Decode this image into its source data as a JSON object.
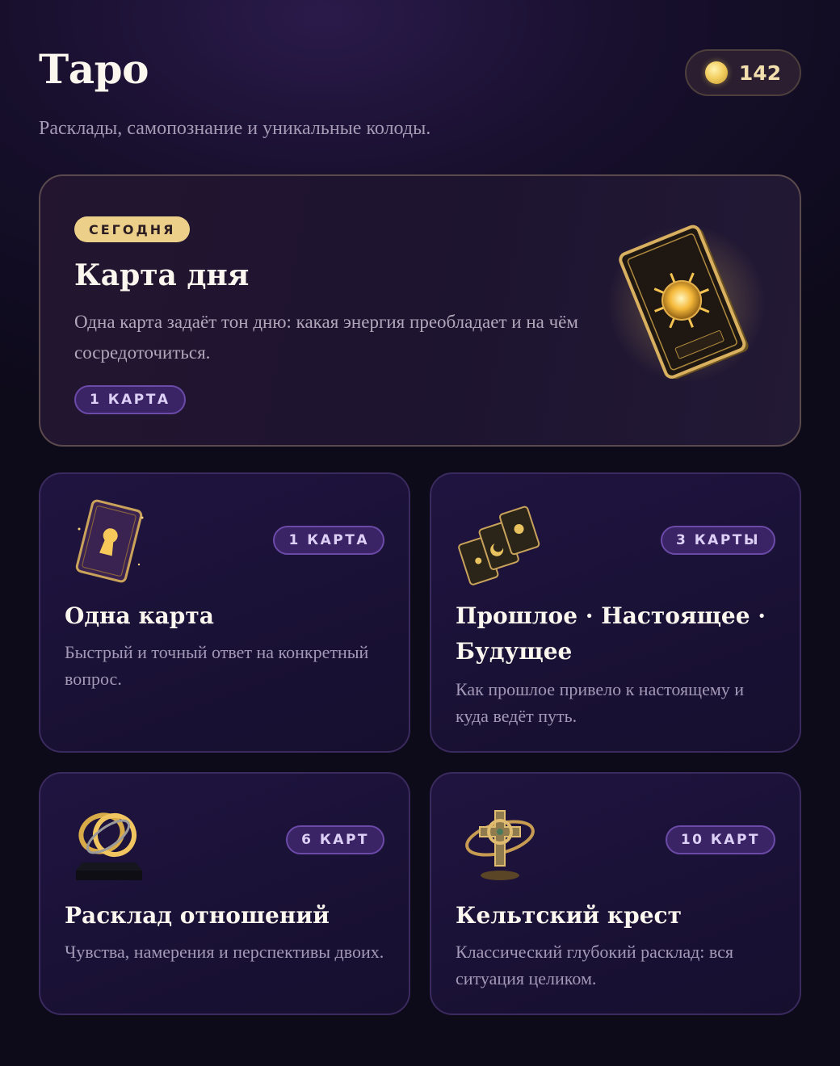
{
  "header": {
    "title": "Таро",
    "coins": "142",
    "coin_icon": "gold-coin-icon"
  },
  "subtitle": "Расклады, самопознание и уникальные колоды.",
  "featured": {
    "badge": "СЕГОДНЯ",
    "title": "Карта дня",
    "description": "Одна карта задаёт тон дню: какая энергия преобладает и на чём сосредоточиться.",
    "count": "1 КАРТА",
    "art_icon": "sun-tarot-card-image"
  },
  "spreads": [
    {
      "title": "Одна карта",
      "description": "Быстрый и точный ответ на конкретный вопрос.",
      "count": "1 КАРТА",
      "icon": "keyhole-card-image"
    },
    {
      "title": "Прошлое · Настоящее · Будущее",
      "description": "Как прошлое привело к настоящему и куда ведёт путь.",
      "count": "3 КАРТЫ",
      "icon": "three-cards-image"
    },
    {
      "title": "Расклад отношений",
      "description": "Чувства, намерения и перспективы двоих.",
      "count": "6 КАРТ",
      "icon": "rings-image"
    },
    {
      "title": "Кельтский крест",
      "description": "Классический глубокий расклад: вся ситуация целиком.",
      "count": "10 КАРТ",
      "icon": "celtic-cross-image"
    }
  ],
  "colors": {
    "accent_gold": "#ecd089",
    "pill_purple": "#3b2466",
    "background": "#0d0a1a"
  }
}
